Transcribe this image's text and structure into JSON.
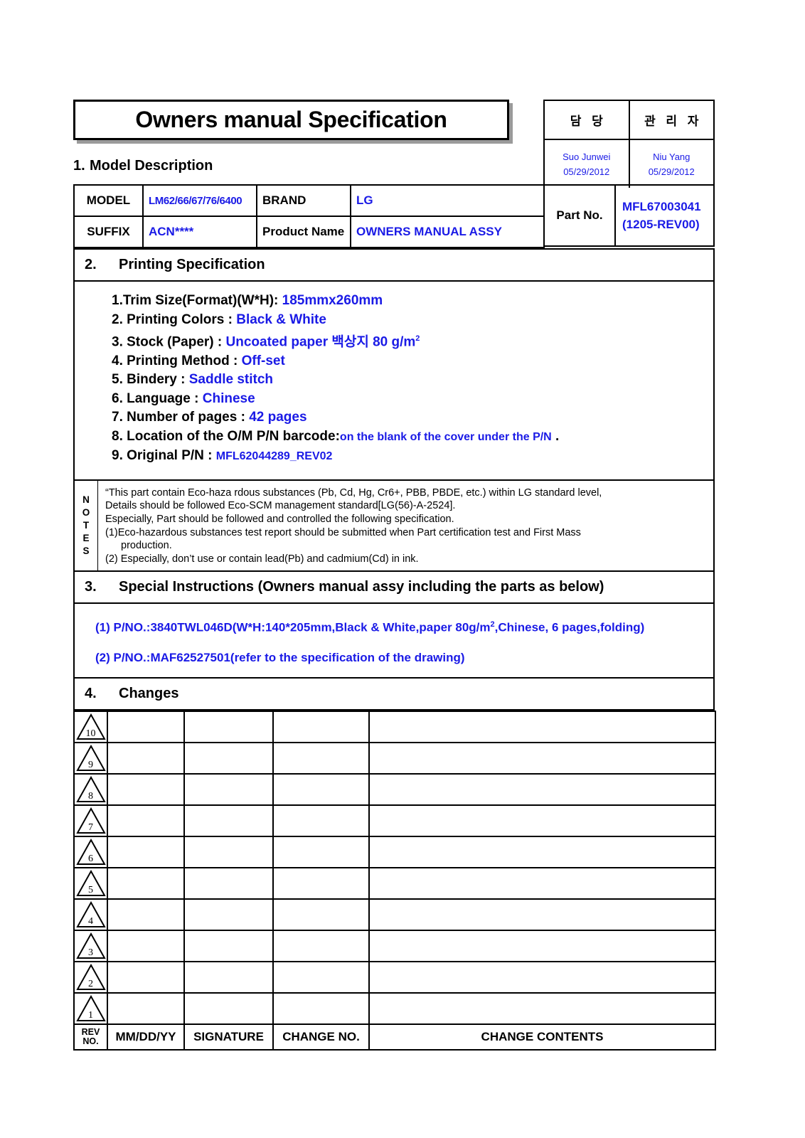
{
  "title": "Owners manual Specification",
  "approval": {
    "columns": [
      {
        "role": "담 당",
        "name": "Suo Junwei",
        "date": "05/29/2012"
      },
      {
        "role": "관 리 자",
        "name": "Niu Yang",
        "date": "05/29/2012"
      }
    ],
    "accent_color": "#1a1ae6"
  },
  "section1": {
    "number": "1.",
    "title": "Model Description",
    "rows": [
      {
        "label1": "MODEL",
        "value1": "LM62/66/67/76/6400",
        "label2": "BRAND",
        "value2": "LG"
      },
      {
        "label1": "SUFFIX",
        "value1": "ACN****",
        "label2": "Product Name",
        "value2": "OWNERS MANUAL ASSY"
      }
    ],
    "part_no_label": "Part No.",
    "part_no_value_line1": "MFL67003041",
    "part_no_value_line2": "(1205-REV00)"
  },
  "section2": {
    "number": "2.",
    "title": "Printing Specification",
    "items": [
      {
        "label": "1.Trim Size(Format)(W*H): ",
        "value": "185mmx260mm"
      },
      {
        "label": "2. Printing Colors : ",
        "value": "Black & White"
      },
      {
        "label": "3. Stock (Paper) : ",
        "value": "Uncoated paper 백상지 80 g/m",
        "sup": "2"
      },
      {
        "label": "4. Printing Method : ",
        "value": "Off-set"
      },
      {
        "label": "5. Bindery  : ",
        "value": "Saddle stitch"
      },
      {
        "label": "6. Language : ",
        "value": "Chinese"
      },
      {
        "label": "7. Number of pages :  ",
        "value": "42 pages"
      },
      {
        "label": "8. Location of the O/M P/N barcode:",
        "value": "on the blank of the cover under the P/N",
        "suffix": " ."
      },
      {
        "label": "9. Original P/N : ",
        "value": "MFL62044289_REV02"
      }
    ]
  },
  "notes": {
    "label": "NOTES",
    "lines": [
      {
        "text": "“This part contain Eco-haza rdous substances (Pb, Cd, Hg, Cr6+, PBB, PBDE, etc.) within LG standard level,",
        "indent": false
      },
      {
        "text": "Details should be followed Eco-SCM management standard[LG(56)-A-2524].",
        "indent": false
      },
      {
        "text": "Especially, Part should be followed and controlled the following specification.",
        "indent": false
      },
      {
        "text": "(1)Eco-hazardous substances test  report should be submitted when  Part certification test and First Mass",
        "indent": false
      },
      {
        "text": "production.",
        "indent": true
      },
      {
        "text": "(2) Especially, don’t use or contain lead(Pb) and cadmium(Cd) in ink.",
        "indent": false
      }
    ]
  },
  "section3": {
    "number": "3.",
    "title": "Special Instructions (Owners manual assy including the parts as below)",
    "items": [
      {
        "pre": "(1) P/NO.:3840TWL046D(W*H:140*205mm,Black & White,paper 80g/m",
        "sup": "2",
        "post": ",Chinese, 6 pages,folding)"
      },
      {
        "pre": "(2) P/NO.:MAF62527501(refer to the specification of the drawing)",
        "sup": "",
        "post": ""
      }
    ]
  },
  "section4": {
    "number": "4.",
    "title": "Changes",
    "rev_numbers": [
      "10",
      "9",
      "8",
      "7",
      "6",
      "5",
      "4",
      "3",
      "2",
      "1"
    ],
    "footer": {
      "rev_line1": "REV",
      "rev_line2": "NO.",
      "date": "MM/DD/YY",
      "signature": "SIGNATURE",
      "change_no": "CHANGE NO.",
      "change_contents": "CHANGE   CONTENTS"
    }
  }
}
